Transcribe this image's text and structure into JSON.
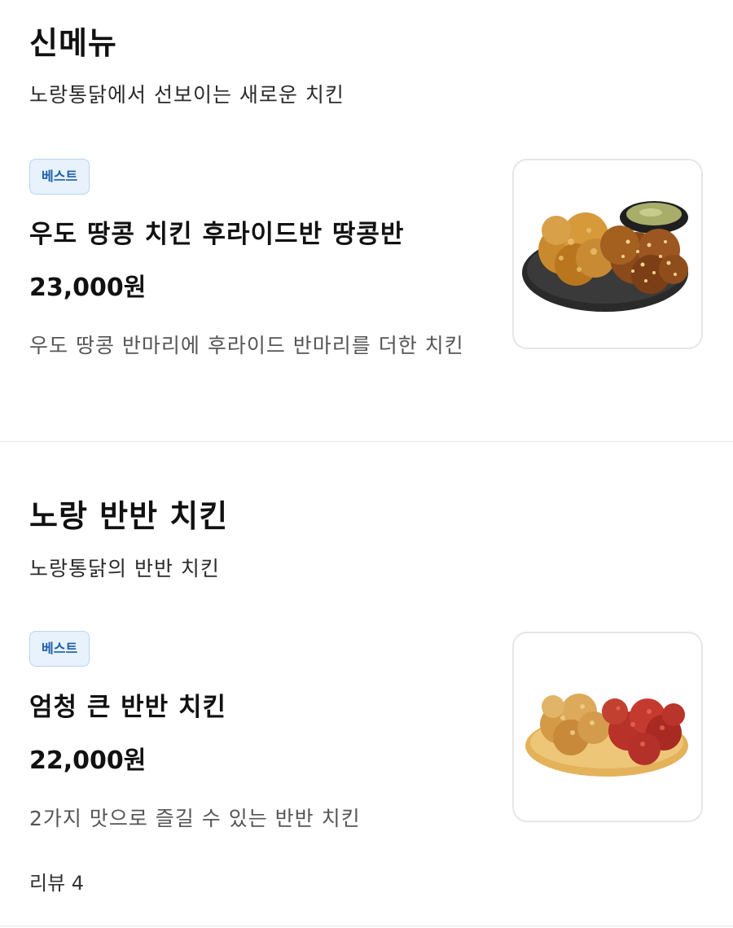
{
  "sections": [
    {
      "title": "신메뉴",
      "subtitle": "노랑통닭에서 선보이는 새로운 치킨",
      "items": [
        {
          "badge": "베스트",
          "name": "우도 땅콩 치킨 후라이드반 땅콩반",
          "price": "23,000원",
          "description": "우도 땅콩 반마리에 후라이드 반마리를 더한 치킨",
          "image_icon": "chicken-photo-fried-peanut-with-sauce"
        }
      ]
    },
    {
      "title": "노랑 반반 치킨",
      "subtitle": "노랑통닭의 반반 치킨",
      "items": [
        {
          "badge": "베스트",
          "name": "엄청 큰 반반 치킨",
          "price": "22,000원",
          "description": "2가지 맛으로 즐길 수 있는 반반 치킨",
          "review": "리뷰 4",
          "image_icon": "chicken-photo-half-fried-half-spicy"
        }
      ]
    }
  ],
  "colors": {
    "badge_bg": "#e8f2fc",
    "badge_border": "#b9d4ee",
    "badge_text": "#1d5fa8",
    "divider": "#e9e9e9"
  }
}
